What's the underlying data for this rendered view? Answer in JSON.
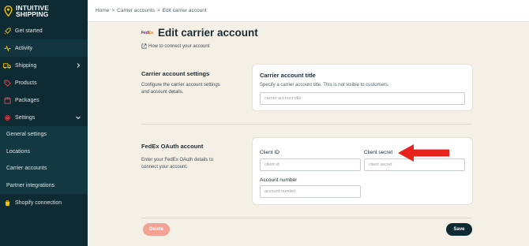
{
  "brand": {
    "line1": "INTUITIVE",
    "line2": "SHIPPING",
    "pin_color": "#f5c400"
  },
  "sidebar": {
    "items": [
      {
        "label": "Get started",
        "icon": "rocket-icon"
      },
      {
        "label": "Activity",
        "icon": "pulse-icon"
      },
      {
        "label": "Shipping",
        "icon": "truck-icon"
      },
      {
        "label": "Products",
        "icon": "tag-icon"
      },
      {
        "label": "Packages",
        "icon": "box-icon"
      },
      {
        "label": "Settings",
        "icon": "gear-icon"
      }
    ],
    "settings_sub": [
      "General settings",
      "Locations",
      "Carrier accounts",
      "Partner integrations"
    ],
    "shopify": {
      "label": "Shopify connection",
      "icon": "shopify-icon"
    }
  },
  "breadcrumb": {
    "home": "Home",
    "carrier_accounts": "Carrier accounts",
    "current": "Edit carrier account",
    "separator": ">"
  },
  "page": {
    "title": "Edit carrier account",
    "carrier_logo": {
      "fe": "Fed",
      "ex": "Ex"
    },
    "help_link": "How to connect your account"
  },
  "carrier_settings": {
    "title": "Carrier account settings",
    "description": "Configure the carrier account settings and account details.",
    "card": {
      "title": "Carrier account title",
      "subtitle": "Specify a carrier account title. This is not visible to customers.",
      "placeholder": "carrier account title"
    }
  },
  "oauth": {
    "title": "FedEx OAuth account",
    "description": "Enter your FedEx OAuth details to connect your account.",
    "client_id": {
      "label": "Client ID",
      "placeholder": "client id"
    },
    "client_secret": {
      "label": "Client secret",
      "placeholder": "client secret"
    },
    "account_number": {
      "label": "Account number",
      "placeholder": "account number"
    }
  },
  "actions": {
    "delete": "Delete",
    "save": "Save"
  },
  "colors": {
    "sidebar_bg": "#0e2a33",
    "page_bg": "#f5f0e6",
    "delete_bg": "#f4a196",
    "arrow": "#e8231d",
    "accent_yellow": "#f5c400"
  }
}
